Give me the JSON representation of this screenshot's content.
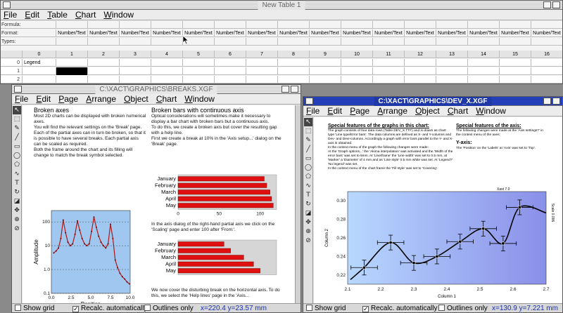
{
  "app": {
    "menu": [
      "File",
      "Edit",
      "Table",
      "Chart",
      "Window"
    ]
  },
  "table_window": {
    "title": "New Table 1",
    "row_labels": [
      "Formula:",
      "Format:",
      "Types:"
    ],
    "format_label": "Number/Text",
    "columns": [
      "0",
      "1",
      "2",
      "3",
      "4",
      "5",
      "6",
      "7",
      "8",
      "9",
      "10",
      "11",
      "12",
      "13",
      "14",
      "15",
      "16"
    ],
    "rows": [
      {
        "num": "0",
        "first": "Legend"
      },
      {
        "num": "1",
        "first": ""
      },
      {
        "num": "2",
        "first": ""
      }
    ]
  },
  "window_left": {
    "title": "C:\\XACT\\GRAPHICS\\BREAKS.XGF",
    "menu": [
      "File",
      "Edit",
      "Page",
      "Arrange",
      "Object",
      "Chart",
      "Window"
    ],
    "text_left": {
      "heading": "Broken axes",
      "body": "Most 2D charts can be displayed with broken numerical axes.\nYou will find the relevant settings on the 'Break' page.\nEach of the partial axes can in turn be broken, so that it is possible to have several breaks. Each partial axis can be scaled as required.\nBoth the frame around the chart and its filling will change to match the break symbol selected."
    },
    "text_right": {
      "heading": "Broken bars with continuous axis",
      "body": "Optical considerations will sometimes make it necessary to display a bar chart with broken bars but a continuous axis.\nTo do this, we create a broken axis but cover the resulting gap with a help line.\nFirst we create a break at 10% in the 'Axis setup...' dialog on the 'Break' page.",
      "middle": "In the axis dialog of the right-hand partial axis we click on the 'Scaling' page and enter 100 after 'From:'.",
      "bottom": "We now cover the disturbing break on the horizontal axis. To do this, we select the 'Help lines' page in the 'Axis..."
    },
    "status": {
      "show_grid": "Show grid",
      "recalc": "Recalc. automatically",
      "outlines": "Outlines only",
      "coords": "x=220.4  y=23.57 mm"
    }
  },
  "window_right": {
    "title": "C:\\XACT\\GRAPHICS\\DEV_X.XGF",
    "menu": [
      "File",
      "Edit",
      "Page",
      "Arrange",
      "Object",
      "Chart",
      "Window"
    ],
    "text_left": {
      "heading": "Special features of the graphs in this chart:",
      "body": "The graph consists of four data rows (Table DEV_X.TTF) and is drawn as chart type 'Line type/Error bars'. The data columns are defined as X- and Y-columns and Dev- and Devi-columns. Accordingly a graph with error bars parallel to the Y- and X-axis is obtained.\nIn the context menu of the graph the following changes were made:\nAt the 'Graph options...' the 'Akima interpolation' was activated and the 'Width of the error bars' was set to 6mm. At 'Line/frame' the 'Line width' was set to 0.5 mm, at 'Marker' a 'Diameter' of 4 mm and as 'Line style' 0.5 mm white was set. At 'Legend?' 'No legend' was set.\nIn the context menu of the chart frame the 'Fill style' was set to 'Covering'."
    },
    "text_right": {
      "heading": "Special features of the axis:",
      "body": "The following changes were made at the 'Axis settings?' in the context menu of the axes:",
      "subheading": "Y-axis:",
      "body2": "The 'Position' on the 'Labels' at 'Axis' was set to 'Top'."
    },
    "status": {
      "show_grid": "Show grid",
      "recalc": "Recalc. automatically",
      "outlines": "Outlines only",
      "coords": "x=130.9  y=7.221 mm"
    }
  },
  "chart_data": [
    {
      "type": "line",
      "title": "",
      "xlabel": "Position",
      "ylabel": "Amplitude",
      "yscale": "log",
      "xlim": [
        0,
        10
      ],
      "ylim": [
        0.1,
        300
      ],
      "x_ticks": [
        "0.0",
        "2.5",
        "5.0",
        "7.5",
        "10.0"
      ],
      "y_ticks": [
        "0.1",
        "1.0",
        "10",
        "100"
      ],
      "series": [
        {
          "values_description_x": [
            0.3,
            0.6,
            0.9,
            1.2,
            1.5,
            1.8,
            2.1,
            2.4,
            2.7,
            3.0,
            3.3,
            3.6,
            3.9,
            4.2,
            4.5,
            4.8,
            5.1,
            5.4,
            5.7,
            6.0,
            6.3,
            6.6,
            6.9,
            7.2,
            7.5,
            7.8,
            8.1,
            8.4,
            8.7,
            9.0,
            9.3,
            9.6,
            9.9
          ],
          "y": [
            5,
            6,
            8,
            20,
            120,
            35,
            14,
            10,
            12,
            30,
            110,
            45,
            20,
            12,
            10,
            12,
            40,
            160,
            60,
            25,
            14,
            10,
            8,
            12,
            80,
            20,
            2.5,
            1.2,
            0.7,
            0.5,
            0.4,
            0.3,
            0.25
          ]
        }
      ]
    },
    {
      "type": "bar",
      "orientation": "horizontal",
      "categories": [
        "January",
        "February",
        "March",
        "April",
        "May"
      ],
      "values": [
        105,
        108,
        112,
        114,
        116
      ],
      "xlim": [
        0,
        120
      ],
      "x_ticks": [
        "0",
        "50",
        "100"
      ]
    },
    {
      "type": "bar",
      "orientation": "horizontal",
      "categories": [
        "January",
        "February",
        "March",
        "April",
        "May"
      ],
      "values": [
        104,
        106,
        110,
        113,
        115
      ],
      "xlim": [
        90,
        120
      ]
    },
    {
      "type": "line",
      "title": "",
      "xlabel": "Column 1",
      "ylabel": "Column 2",
      "right_label": "Scale 0.006",
      "top_label": "Xaxt 7.0",
      "xlim": [
        2.1,
        2.7
      ],
      "ylim": [
        0.21,
        0.31
      ],
      "x_ticks": [
        "2.1",
        "2.2",
        "2.3",
        "2.4",
        "2.5",
        "2.6",
        "2.7"
      ],
      "y_ticks": [
        "0.22",
        "0.24",
        "0.26",
        "0.28",
        "0.30"
      ],
      "series": [
        {
          "x": [
            2.15,
            2.23,
            2.3,
            2.37,
            2.44,
            2.51,
            2.57,
            2.62
          ],
          "y": [
            0.228,
            0.255,
            0.233,
            0.24,
            0.256,
            0.27,
            0.254,
            0.293
          ],
          "x_err": 0.04,
          "y_err": 0.008
        }
      ]
    }
  ]
}
